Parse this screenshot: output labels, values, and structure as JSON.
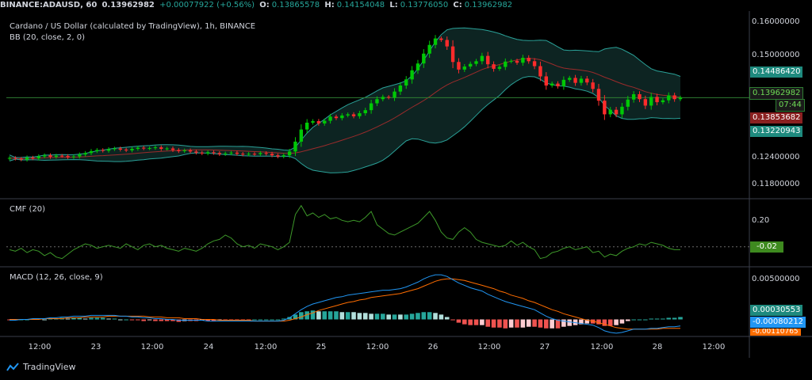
{
  "topbar": {
    "symbol": "BINANCE:ADAUSD, 60",
    "last": "0.13962982",
    "change": "+0.00077922 (+0.56%)",
    "o_label": "O:",
    "o": "0.13865578",
    "h_label": "H:",
    "h": "0.14154048",
    "l_label": "L:",
    "l": "0.13776050",
    "c_label": "C:",
    "c": "0.13962982"
  },
  "legends": {
    "main_title": "Cardano / US Dollar (calculated by TradingView), 1h, BINANCE",
    "bb": "BB (20, close, 2, 0)",
    "cmf": "CMF (20)",
    "macd": "MACD (12, 26, close, 9)"
  },
  "price_axis": [
    "0.16000000",
    "0.15000000",
    "0.12400000",
    "0.11800000"
  ],
  "cmf_axis": [
    "0.20"
  ],
  "macd_axis": [
    "0.00500000"
  ],
  "price_tags": {
    "bb_upper": "0.14486420",
    "last": "0.13962982",
    "countdown": "07:44",
    "bb_basis": "0.13853682",
    "bb_lower": "0.13220943",
    "cmf": "-0.02",
    "macd_hist": "0.00030553",
    "macd_line": "-0.00080212",
    "macd_signal": "-0.00110765"
  },
  "time_axis": [
    "12:00",
    "23",
    "12:00",
    "24",
    "12:00",
    "25",
    "12:00",
    "26",
    "12:00",
    "27",
    "12:00",
    "28",
    "12:00"
  ],
  "footer": {
    "brand": "TradingView"
  },
  "colors": {
    "up": "#00c805",
    "down": "#ff2b2b",
    "bb_band": "#2aa198",
    "bb_basis": "#9b2b2b",
    "cmf": "#3e9a2a",
    "macd": "#2196f3",
    "signal": "#ff6d00",
    "hist_pos": "#26a69a",
    "hist_neg": "#ef5350"
  },
  "chart_data": {
    "type": "candlestick",
    "title": "Cardano / US Dollar (calculated by TradingView), 1h, BINANCE",
    "ylim": [
      0.114,
      0.162
    ],
    "closes": [
      0.1237,
      0.1235,
      0.1233,
      0.1238,
      0.1236,
      0.1241,
      0.1244,
      0.124,
      0.1243,
      0.1242,
      0.1239,
      0.1241,
      0.1246,
      0.125,
      0.1255,
      0.1258,
      0.1256,
      0.126,
      0.1262,
      0.1259,
      0.1257,
      0.1261,
      0.1264,
      0.1262,
      0.1263,
      0.1265,
      0.1261,
      0.1262,
      0.1258,
      0.1255,
      0.1257,
      0.1254,
      0.1251,
      0.1249,
      0.1252,
      0.125,
      0.1247,
      0.1249,
      0.1251,
      0.1248,
      0.1246,
      0.1248,
      0.1247,
      0.125,
      0.1248,
      0.1244,
      0.1241,
      0.1244,
      0.1254,
      0.128,
      0.1312,
      0.133,
      0.1334,
      0.1328,
      0.1335,
      0.1346,
      0.1342,
      0.1349,
      0.1352,
      0.1347,
      0.1355,
      0.1363,
      0.1381,
      0.1392,
      0.1398,
      0.1396,
      0.1412,
      0.1428,
      0.1444,
      0.1468,
      0.1486,
      0.1512,
      0.1535,
      0.1552,
      0.1548,
      0.1531,
      0.149,
      0.147,
      0.1478,
      0.1485,
      0.1492,
      0.1506,
      0.1484,
      0.1472,
      0.1477,
      0.1491,
      0.1493,
      0.1488,
      0.1501,
      0.1492,
      0.1479,
      0.1452,
      0.1428,
      0.1433,
      0.1426,
      0.1443,
      0.1448,
      0.1435,
      0.1446,
      0.1436,
      0.1419,
      0.1388,
      0.1352,
      0.1364,
      0.1352,
      0.1372,
      0.1391,
      0.1405,
      0.1392,
      0.1375,
      0.1398,
      0.1384,
      0.1389,
      0.1402,
      0.1392,
      0.1396
    ],
    "cmf_range": [
      -0.12,
      0.3
    ],
    "cmf_values": [
      -0.02,
      -0.03,
      -0.01,
      -0.04,
      -0.02,
      -0.03,
      -0.06,
      -0.04,
      -0.07,
      -0.08,
      -0.05,
      -0.02,
      0.0,
      0.02,
      0.01,
      -0.01,
      0.0,
      0.01,
      0.0,
      -0.01,
      0.02,
      0.0,
      -0.02,
      0.01,
      0.02,
      0.0,
      0.01,
      -0.01,
      -0.02,
      -0.03,
      -0.01,
      -0.02,
      -0.03,
      -0.01,
      0.02,
      0.04,
      0.05,
      0.08,
      0.06,
      0.02,
      0.0,
      0.01,
      -0.01,
      0.02,
      0.01,
      0.0,
      -0.02,
      0.0,
      0.03,
      0.22,
      0.28,
      0.21,
      0.23,
      0.2,
      0.22,
      0.19,
      0.2,
      0.18,
      0.17,
      0.18,
      0.17,
      0.2,
      0.24,
      0.15,
      0.12,
      0.09,
      0.08,
      0.1,
      0.12,
      0.14,
      0.16,
      0.2,
      0.24,
      0.18,
      0.1,
      0.06,
      0.05,
      0.1,
      0.13,
      0.1,
      0.05,
      0.03,
      0.02,
      0.01,
      0.0,
      0.01,
      0.04,
      0.01,
      0.03,
      0.0,
      -0.02,
      -0.08,
      -0.07,
      -0.04,
      -0.03,
      -0.01,
      0.0,
      -0.02,
      -0.01,
      0.0,
      -0.04,
      -0.03,
      -0.07,
      -0.05,
      -0.06,
      -0.03,
      -0.01,
      0.0,
      0.02,
      0.01,
      0.03,
      0.02,
      0.01,
      -0.01,
      -0.02,
      -0.02
    ],
    "macd_range": [
      -0.002,
      0.006
    ],
    "macd_line_values": [
      -0.0001,
      -0.0001,
      0.0,
      0.0,
      0.0001,
      0.0001,
      0.0001,
      0.0002,
      0.0002,
      0.0003,
      0.0003,
      0.0004,
      0.0004,
      0.0004,
      0.0005,
      0.0005,
      0.0005,
      0.0005,
      0.0005,
      0.0004,
      0.0004,
      0.0003,
      0.0003,
      0.0002,
      0.0002,
      0.0001,
      0.0001,
      0.0,
      0.0,
      -0.0001,
      -0.0001,
      -0.0001,
      -0.0001,
      -0.0001,
      -0.0002,
      -0.0002,
      -0.0002,
      -0.0002,
      -0.0002,
      -0.0002,
      -0.0002,
      -0.0002,
      -0.0002,
      -0.0002,
      -0.0002,
      -0.0002,
      -0.0002,
      -0.0001,
      0.0002,
      0.0007,
      0.0012,
      0.0016,
      0.0019,
      0.0021,
      0.0023,
      0.0025,
      0.0027,
      0.0028,
      0.003,
      0.0031,
      0.0032,
      0.0033,
      0.0034,
      0.0035,
      0.0036,
      0.0036,
      0.0037,
      0.0038,
      0.004,
      0.0043,
      0.0046,
      0.005,
      0.0053,
      0.0055,
      0.0055,
      0.0053,
      0.0049,
      0.0045,
      0.0042,
      0.0039,
      0.0037,
      0.0035,
      0.0031,
      0.0028,
      0.0025,
      0.0022,
      0.002,
      0.0018,
      0.0016,
      0.0014,
      0.0012,
      0.0008,
      0.0004,
      0.0001,
      -0.0001,
      -0.0002,
      -0.0003,
      -0.0004,
      -0.0005,
      -0.0006,
      -0.0007,
      -0.001,
      -0.0014,
      -0.0016,
      -0.0017,
      -0.0016,
      -0.0014,
      -0.0012,
      -0.0012,
      -0.0012,
      -0.0011,
      -0.0011,
      -0.001,
      -0.0009,
      -0.0009,
      -0.0008
    ],
    "macd_signal_values": [
      0.0,
      0.0,
      0.0,
      0.0,
      0.0,
      0.0,
      0.0001,
      0.0001,
      0.0001,
      0.0001,
      0.0002,
      0.0002,
      0.0002,
      0.0003,
      0.0003,
      0.0003,
      0.0003,
      0.0004,
      0.0004,
      0.0004,
      0.0004,
      0.0004,
      0.0004,
      0.0004,
      0.0003,
      0.0003,
      0.0003,
      0.0002,
      0.0002,
      0.0002,
      0.0001,
      0.0001,
      0.0001,
      0.0,
      0.0,
      0.0,
      -0.0001,
      -0.0001,
      -0.0001,
      -0.0001,
      -0.0001,
      -0.0001,
      -0.0002,
      -0.0002,
      -0.0002,
      -0.0002,
      -0.0002,
      -0.0002,
      -0.0001,
      0.0001,
      0.0003,
      0.0006,
      0.0008,
      0.0011,
      0.0013,
      0.0015,
      0.0017,
      0.0019,
      0.0021,
      0.0022,
      0.0024,
      0.0025,
      0.0027,
      0.0028,
      0.0029,
      0.003,
      0.0031,
      0.0032,
      0.0034,
      0.0036,
      0.0038,
      0.0041,
      0.0044,
      0.0047,
      0.0049,
      0.005,
      0.005,
      0.0049,
      0.0048,
      0.0046,
      0.0044,
      0.0042,
      0.004,
      0.0038,
      0.0035,
      0.0033,
      0.003,
      0.0028,
      0.0026,
      0.0023,
      0.0021,
      0.0018,
      0.0015,
      0.0012,
      0.001,
      0.0007,
      0.0005,
      0.0003,
      0.0001,
      -0.0001,
      -0.0002,
      -0.0004,
      -0.0006,
      -0.0008,
      -0.001,
      -0.0011,
      -0.0012,
      -0.0012,
      -0.0012,
      -0.0012,
      -0.0012,
      -0.0012,
      -0.0011,
      -0.0011,
      -0.0011,
      -0.0011
    ]
  }
}
